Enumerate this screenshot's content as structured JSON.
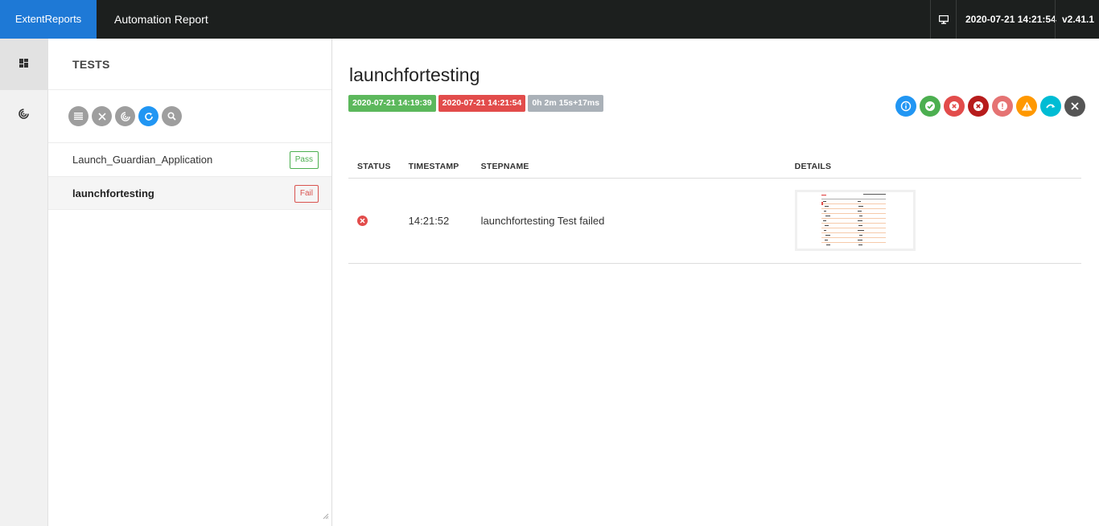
{
  "topbar": {
    "brand": "ExtentReports",
    "report_name": "Automation Report",
    "datetime": "2020-07-21 14:21:54",
    "version": "v2.41.1",
    "icons": [
      "monitor-icon"
    ]
  },
  "nav": {
    "items": [
      {
        "name": "dashboard",
        "icon": "dashboard-icon",
        "active": true
      },
      {
        "name": "analysis",
        "icon": "chart-icon",
        "active": false
      }
    ]
  },
  "tests_panel": {
    "title": "TESTS",
    "filters": [
      "list-icon",
      "close-icon",
      "fingerprint-icon",
      "refresh-icon",
      "search-icon"
    ],
    "tests": [
      {
        "name": "Launch_Guardian_Application",
        "status": "Pass"
      },
      {
        "name": "launchfortesting",
        "status": "Fail"
      }
    ]
  },
  "test_view": {
    "title": "launchfortesting",
    "start_time": "2020-07-21 14:19:39",
    "end_time": "2020-07-21 14:21:54",
    "duration": "0h 2m 15s+17ms",
    "status_filters": [
      "info-icon",
      "pass-icon",
      "fail-icon",
      "fatal-icon",
      "error-icon",
      "warning-icon",
      "skip-icon",
      "clear-icon"
    ],
    "colors": {
      "info": "#2196f3",
      "pass": "#4caf50",
      "fail": "#e24c4b",
      "fatal": "#b71c1c",
      "error": "#e57373",
      "warning": "#ff9800",
      "skip": "#00bcd4",
      "clear": "#555555"
    },
    "columns": [
      "STATUS",
      "TIMESTAMP",
      "STEPNAME",
      "DETAILS"
    ],
    "steps": [
      {
        "status": "fail",
        "timestamp": "14:21:52",
        "stepname": "launchfortesting Test failed"
      }
    ]
  }
}
